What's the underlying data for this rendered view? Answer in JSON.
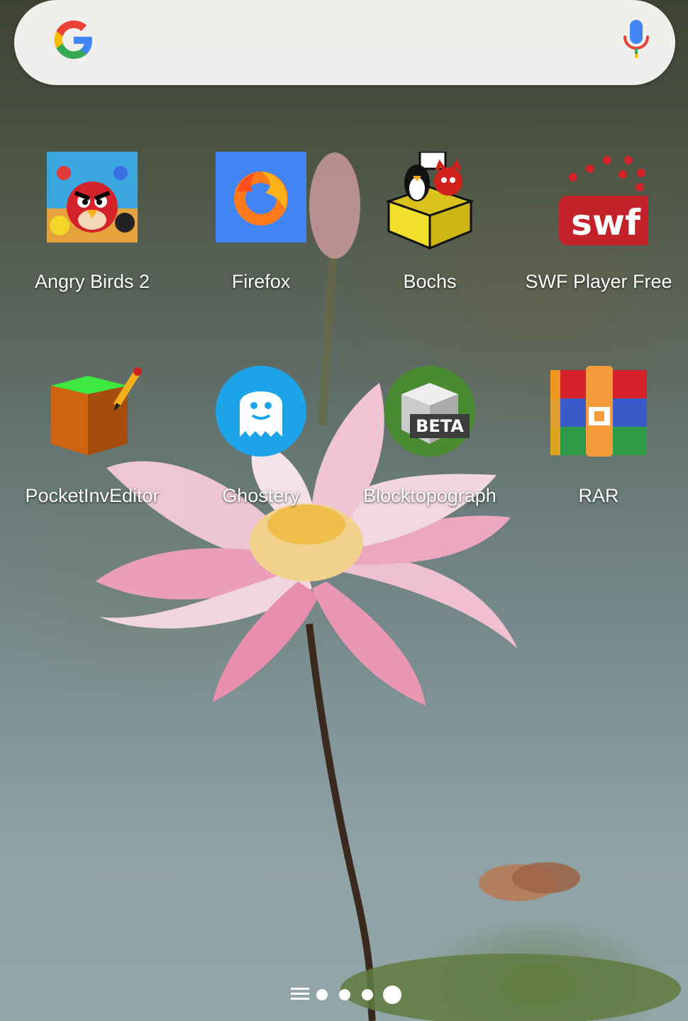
{
  "search": {
    "logo_icon": "google-g-logo",
    "mic_icon": "microphone-icon",
    "colors": {
      "blue": "#4285F4",
      "red": "#EA4335",
      "yellow": "#FBBC05",
      "green": "#34A853"
    }
  },
  "apps": [
    {
      "label": "Angry Birds 2",
      "icon": "angry-birds-2-icon"
    },
    {
      "label": "Firefox",
      "icon": "firefox-icon"
    },
    {
      "label": "Bochs",
      "icon": "bochs-icon"
    },
    {
      "label": "SWF Player Free",
      "icon": "swf-player-icon",
      "badge_text": "swf"
    },
    {
      "label": "PocketInvEditor",
      "icon": "pocketinveditor-icon"
    },
    {
      "label": "Ghostery",
      "icon": "ghostery-icon"
    },
    {
      "label": "Blocktopograph",
      "icon": "blocktopograph-icon",
      "badge_text": "BETA"
    },
    {
      "label": "RAR",
      "icon": "rar-icon"
    }
  ],
  "page_indicator": {
    "menu_icon": "app-drawer-menu-icon",
    "pages": 4,
    "current_page": 4
  }
}
